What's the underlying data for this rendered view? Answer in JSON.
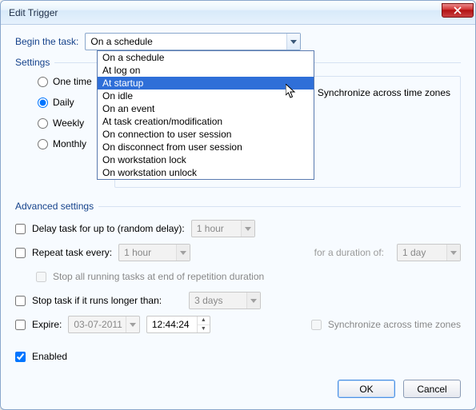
{
  "title": "Edit Trigger",
  "begin_label": "Begin the task:",
  "begin_value": "On a schedule",
  "dropdown": {
    "options": [
      "On a schedule",
      "At log on",
      "At startup",
      "On idle",
      "On an event",
      "At task creation/modification",
      "On connection to user session",
      "On disconnect from user session",
      "On workstation lock",
      "On workstation unlock"
    ],
    "selected_index": 2
  },
  "settings": {
    "heading": "Settings",
    "radios": {
      "one_time": "One time",
      "daily": "Daily",
      "weekly": "Weekly",
      "monthly": "Monthly",
      "selected": "daily"
    },
    "sync_label": "Synchronize across time zones"
  },
  "advanced": {
    "heading": "Advanced settings",
    "delay_label": "Delay task for up to (random delay):",
    "delay_value": "1 hour",
    "repeat_label": "Repeat task every:",
    "repeat_value": "1 hour",
    "duration_label": "for a duration of:",
    "duration_value": "1 day",
    "stop_all_label": "Stop all running tasks at end of repetition duration",
    "stop_if_label": "Stop task if it runs longer than:",
    "stop_if_value": "3 days",
    "expire_label": "Expire:",
    "expire_date": "03-07-2011",
    "expire_time": "12:44:24",
    "expire_sync_label": "Synchronize across time zones",
    "enabled_label": "Enabled",
    "enabled_checked": true
  },
  "buttons": {
    "ok": "OK",
    "cancel": "Cancel"
  }
}
